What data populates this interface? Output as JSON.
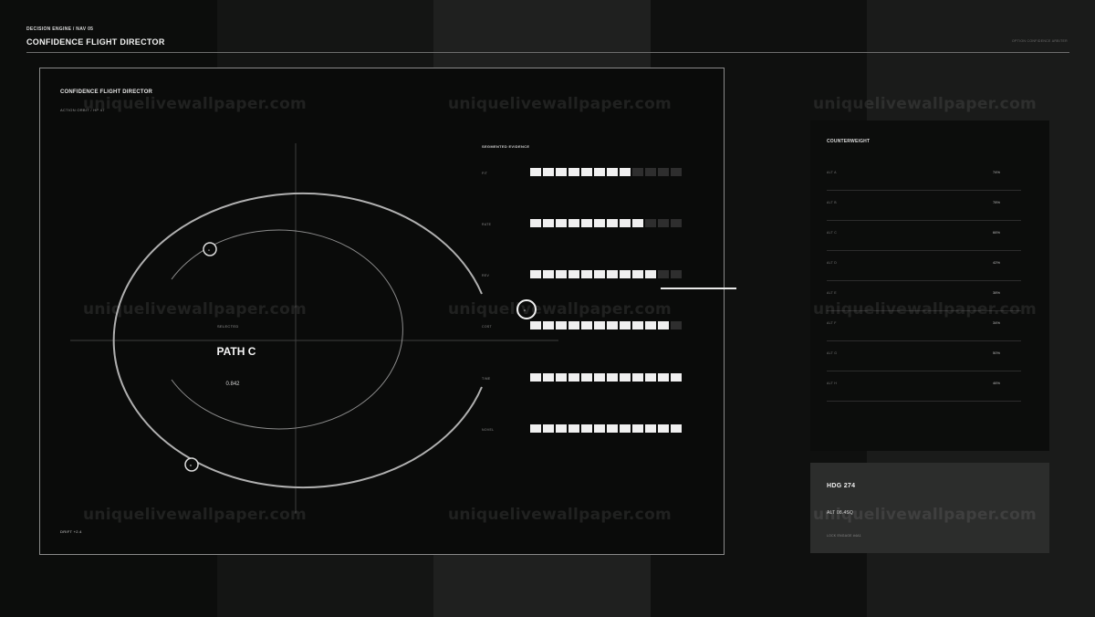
{
  "header": {
    "breadcrumb": "DECISION ENGINE / NAV 05",
    "title": "CONFIDENCE FLIGHT DIRECTOR",
    "selection_text": "OPTION CONFIDENCE ARBITER"
  },
  "director": {
    "title": "CONFIDENCE FLIGHT DIRECTOR",
    "subtitle": "ACTION ORBIT / HP 47",
    "center_label": "SELECTED",
    "path_label": "PATH C",
    "score": "0.842",
    "drift": "DRIFT +2.4",
    "markers": [
      "A",
      "B",
      "C"
    ]
  },
  "evidence": {
    "title": "SEGMENTED EVIDENCE",
    "rows": [
      {
        "label": "FIT",
        "filled": 8,
        "total": 12
      },
      {
        "label": "RATE",
        "filled": 9,
        "total": 12
      },
      {
        "label": "REV",
        "filled": 10,
        "total": 12
      },
      {
        "label": "COST",
        "filled": 11,
        "total": 12
      },
      {
        "label": "TIME",
        "filled": 12,
        "total": 12
      },
      {
        "label": "NOVEL",
        "filled": 12,
        "total": 12
      }
    ]
  },
  "counterweight": {
    "title": "COUNTERWEIGHT",
    "rows": [
      {
        "label": "ALT A",
        "value": "74%"
      },
      {
        "label": "ALT B",
        "value": "78%"
      },
      {
        "label": "ALT C",
        "value": "66%"
      },
      {
        "label": "ALT D",
        "value": "42%"
      },
      {
        "label": "ALT E",
        "value": "38%"
      },
      {
        "label": "ALT F",
        "value": "34%"
      },
      {
        "label": "ALT G",
        "value": "50%"
      },
      {
        "label": "ALT H",
        "value": "46%"
      }
    ]
  },
  "status": {
    "hdg": "HDG  274",
    "alt": "ALT 08.4SQ",
    "lock": "LOCK ENGAGE #4A1"
  },
  "watermark": "uniquelivewallpaper.com",
  "colors": {
    "background": "#0c0d0c",
    "frame": "#8a8a8a",
    "segment_on": "#f0f0f0",
    "segment_off": "#2e2e2e",
    "status_box": "#2c2d2c"
  }
}
